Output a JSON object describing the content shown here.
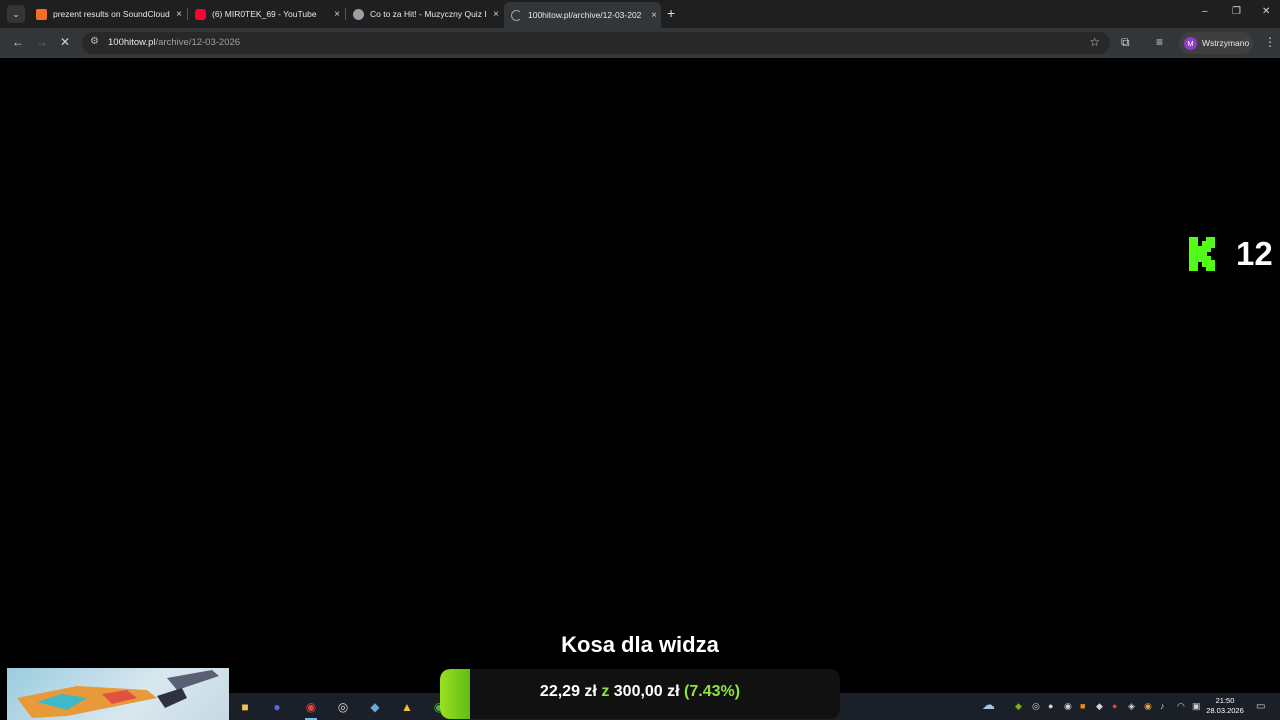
{
  "browser": {
    "tabs": [
      {
        "title": "prezent results on SoundCloud",
        "favicon_color": "#f26f23"
      },
      {
        "title": "(6) MIR0TEK_69 - YouTube",
        "favicon_color": "#ff0033"
      },
      {
        "title": "Co to za Hit! - Muzyczny Quiz I",
        "favicon_color": "#9aa0a6"
      },
      {
        "title": "100hitow.pl/archive/12-03-202",
        "favicon_color": "#9aa0a6"
      }
    ],
    "close_glyph": "×",
    "new_tab_glyph": "+",
    "window_controls": [
      "–",
      "❐",
      "✕"
    ],
    "url_host": "100hitow.pl",
    "url_path": "/archive/12-03-2026",
    "profile_initial": "M",
    "profile_label": "Wstrzymano"
  },
  "page": {
    "logo_letter": "K",
    "logo_color": "#53fc18",
    "count": "12"
  },
  "overlay": {
    "goal_title": "Kosa dla widza",
    "goal_current": "22,29 zł",
    "goal_sep": "z",
    "goal_target": "300,00 zł",
    "goal_percent": "(7.43%)",
    "goal_fraction": 0.0743
  },
  "taskbar": {
    "clock_time": "21:50",
    "clock_date": "28.03.2026"
  }
}
